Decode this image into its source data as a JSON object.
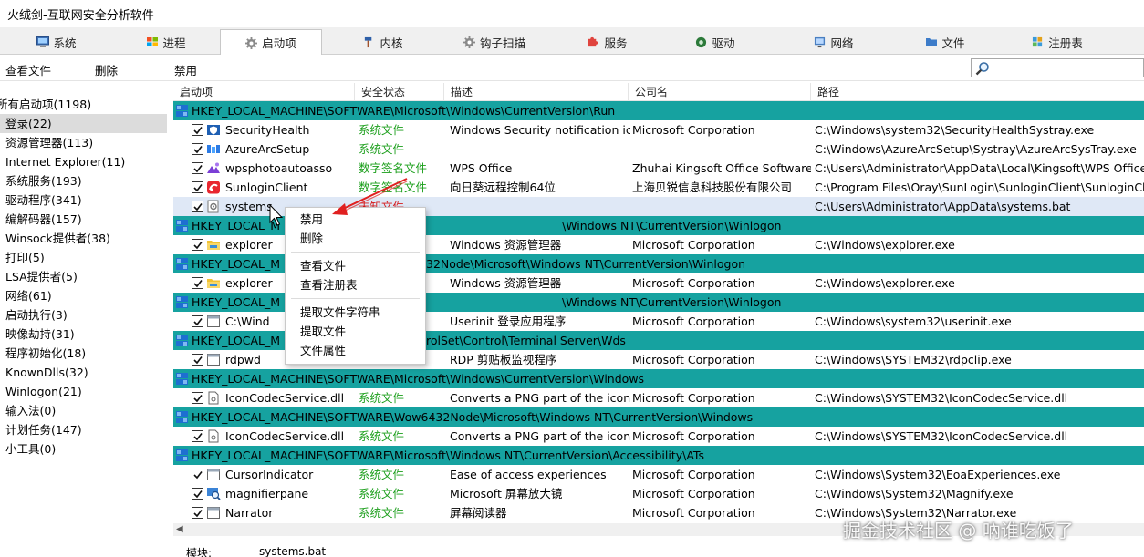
{
  "window": {
    "title": "火绒剑-互联网安全分析软件"
  },
  "tabs": [
    {
      "label": "系统",
      "icon": "monitor-icon"
    },
    {
      "label": "进程",
      "icon": "windows-flag-icon"
    },
    {
      "label": "启动项",
      "icon": "gear-icon",
      "active": true
    },
    {
      "label": "内核",
      "icon": "hammer-icon"
    },
    {
      "label": "钩子扫描",
      "icon": "gear-icon"
    },
    {
      "label": "服务",
      "icon": "puzzle-icon"
    },
    {
      "label": "驱动",
      "icon": "driver-icon"
    },
    {
      "label": "网络",
      "icon": "network-icon"
    },
    {
      "label": "文件",
      "icon": "folder-icon"
    },
    {
      "label": "注册表",
      "icon": "registry-icon"
    }
  ],
  "toolbar": {
    "view_file": "查看文件",
    "delete": "删除",
    "disable": "禁用",
    "search_placeholder": ""
  },
  "categories": [
    {
      "label": "所有启动项(1198)"
    },
    {
      "label": "登录(22)",
      "selected": true
    },
    {
      "label": "资源管理器(113)"
    },
    {
      "label": "Internet Explorer(11)"
    },
    {
      "label": "系统服务(193)"
    },
    {
      "label": "驱动程序(341)"
    },
    {
      "label": "编解码器(157)"
    },
    {
      "label": "Winsock提供者(38)"
    },
    {
      "label": "打印(5)"
    },
    {
      "label": "LSA提供者(5)"
    },
    {
      "label": "网络(61)"
    },
    {
      "label": "启动执行(3)"
    },
    {
      "label": "映像劫持(31)"
    },
    {
      "label": "程序初始化(18)"
    },
    {
      "label": "KnownDlls(32)"
    },
    {
      "label": "Winlogon(21)"
    },
    {
      "label": "输入法(0)"
    },
    {
      "label": "计划任务(147)"
    },
    {
      "label": "小工具(0)"
    }
  ],
  "columns": [
    "启动项",
    "安全状态",
    "描述",
    "公司名",
    "路径"
  ],
  "rows": [
    {
      "type": "group",
      "text": "HKEY_LOCAL_MACHINE\\SOFTWARE\\Microsoft\\Windows\\CurrentVersion\\Run"
    },
    {
      "type": "item",
      "name": "SecurityHealth",
      "icon": "shield-app-icon",
      "status": "系统文件",
      "status_color": "green",
      "desc": "Windows Security notification ic...",
      "company": "Microsoft Corporation",
      "path": "C:\\Windows\\system32\\SecurityHealthSystray.exe"
    },
    {
      "type": "item",
      "name": "AzureArcSetup",
      "icon": "azure-icon",
      "status": "系统文件",
      "status_color": "green",
      "desc": "",
      "company": "",
      "path": "C:\\Windows\\AzureArcSetup\\Systray\\AzureArcSysTray.exe"
    },
    {
      "type": "item",
      "name": "wpsphotoautoasso",
      "icon": "wps-photo-icon",
      "status": "数字签名文件",
      "status_color": "green",
      "desc": "WPS Office",
      "company": "Zhuhai Kingsoft Office Software...",
      "path": "C:\\Users\\Administrator\\AppData\\Local\\Kingsoft\\WPS Office\\12"
    },
    {
      "type": "item",
      "name": "SunloginClient",
      "icon": "sunlogin-icon",
      "status": "数字签名文件",
      "status_color": "green",
      "desc": "向日葵远程控制64位",
      "company": "上海贝锐信息科技股份有限公司",
      "path": "C:\\Program Files\\Oray\\SunLogin\\SunloginClient\\SunloginClient.exe"
    },
    {
      "type": "item",
      "name": "systems",
      "icon": "bat-file-icon",
      "status": "未知文件",
      "status_color": "red",
      "desc": "",
      "company": "",
      "path": "C:\\Users\\Administrator\\AppData\\systems.bat",
      "selected": true
    },
    {
      "type": "group",
      "text": "HKEY_LOCAL_MACHINE\\SOFTWARE\\Microsoft\\Windows NT\\CurrentVersion\\Winlogon",
      "masked_left": "HKEY_LOCAL_M",
      "masked_right": "\\Windows NT\\CurrentVersion\\Winlogon"
    },
    {
      "type": "item",
      "name": "explorer",
      "icon": "explorer-folder-icon",
      "status": "",
      "status_color": "green",
      "desc": "Windows 资源管理器",
      "company": "Microsoft Corporation",
      "path": "C:\\Windows\\explorer.exe"
    },
    {
      "type": "group",
      "text": "HKEY_LOCAL_MACHINE\\SOFTWARE\\Wow6432Node\\Microsoft\\Windows NT\\CurrentVersion\\Winlogon",
      "masked_left": "HKEY_LOCAL_M",
      "masked_right": "32Node\\Microsoft\\Windows NT\\CurrentVersion\\Winlogon"
    },
    {
      "type": "item",
      "name": "explorer",
      "icon": "explorer-folder-icon",
      "status": "",
      "status_color": "green",
      "desc": "Windows 资源管理器",
      "company": "Microsoft Corporation",
      "path": "C:\\Windows\\explorer.exe"
    },
    {
      "type": "group",
      "text": "HKEY_LOCAL_MACHINE\\SOFTWARE\\Microsoft\\Windows NT\\CurrentVersion\\Winlogon",
      "masked_left": "HKEY_LOCAL_M",
      "masked_right": "\\Windows NT\\CurrentVersion\\Winlogon"
    },
    {
      "type": "item",
      "name": "C:\\Windows\\system32\\userinit.exe",
      "short_name": "C:\\Wind",
      "icon": "exe-file-icon",
      "status": "",
      "status_color": "green",
      "desc": "Userinit 登录应用程序",
      "company": "Microsoft Corporation",
      "path": "C:\\Windows\\system32\\userinit.exe"
    },
    {
      "type": "group",
      "text": "HKEY_LOCAL_MACHINE\\SYSTEM\\CurrentControlSet\\Control\\Terminal Server\\Wds",
      "masked_left": "HKEY_LOCAL_M",
      "masked_right": "rolSet\\Control\\Terminal Server\\Wds"
    },
    {
      "type": "item",
      "name": "rdpwd",
      "icon": "exe-file-icon",
      "status": "",
      "status_color": "green",
      "desc": "RDP 剪贴板监视程序",
      "company": "Microsoft Corporation",
      "path": "C:\\Windows\\SYSTEM32\\rdpclip.exe"
    },
    {
      "type": "group",
      "text": "HKEY_LOCAL_MACHINE\\SOFTWARE\\Microsoft\\Windows\\CurrentVersion\\Windows"
    },
    {
      "type": "item",
      "name": "IconCodecService.dll",
      "icon": "dll-file-icon",
      "status": "系统文件",
      "status_color": "green",
      "desc": "Converts a PNG part of the icon...",
      "company": "Microsoft Corporation",
      "path": "C:\\Windows\\SYSTEM32\\IconCodecService.dll"
    },
    {
      "type": "group",
      "text": "HKEY_LOCAL_MACHINE\\SOFTWARE\\Wow6432Node\\Microsoft\\Windows NT\\CurrentVersion\\Windows"
    },
    {
      "type": "item",
      "name": "IconCodecService.dll",
      "icon": "dll-file-icon",
      "status": "系统文件",
      "status_color": "green",
      "desc": "Converts a PNG part of the icon...",
      "company": "Microsoft Corporation",
      "path": "C:\\Windows\\SYSTEM32\\IconCodecService.dll"
    },
    {
      "type": "group",
      "text": "HKEY_LOCAL_MACHINE\\SOFTWARE\\Microsoft\\Windows NT\\CurrentVersion\\Accessibility\\ATs"
    },
    {
      "type": "item",
      "name": "CursorIndicator",
      "icon": "exe-file-icon",
      "status": "系统文件",
      "status_color": "green",
      "desc": "Ease of access experiences",
      "company": "Microsoft Corporation",
      "path": "C:\\Windows\\System32\\EoaExperiences.exe"
    },
    {
      "type": "item",
      "name": "magnifierpane",
      "icon": "magnifier-app-icon",
      "status": "系统文件",
      "status_color": "green",
      "desc": "Microsoft 屏幕放大镜",
      "company": "Microsoft Corporation",
      "path": "C:\\Windows\\System32\\Magnify.exe"
    },
    {
      "type": "item",
      "name": "Narrator",
      "icon": "exe-file-icon",
      "status": "系统文件",
      "status_color": "green",
      "desc": "屏幕阅读器",
      "company": "Microsoft Corporation",
      "path": "C:\\Windows\\System32\\Narrator.exe"
    }
  ],
  "context_menu": {
    "items": [
      "禁用",
      "删除",
      "查看文件",
      "查看注册表",
      "提取文件字符串",
      "提取文件",
      "文件属性"
    ],
    "groups": [
      [
        0,
        1
      ],
      [
        2,
        3
      ],
      [
        4,
        5,
        6
      ]
    ]
  },
  "statusbar": {
    "label": "模块:",
    "value": "systems.bat"
  },
  "watermark": "掘金技术社区 @ 吶谁吃饭了",
  "colors": {
    "group_row": "#16a2a0",
    "selected_category": "#dcdcdc",
    "selected_row": "#dfe8f6",
    "system_file": "#1a9e1a",
    "unknown_file": "#d61c1c",
    "annotation_arrow": "#e02020"
  }
}
